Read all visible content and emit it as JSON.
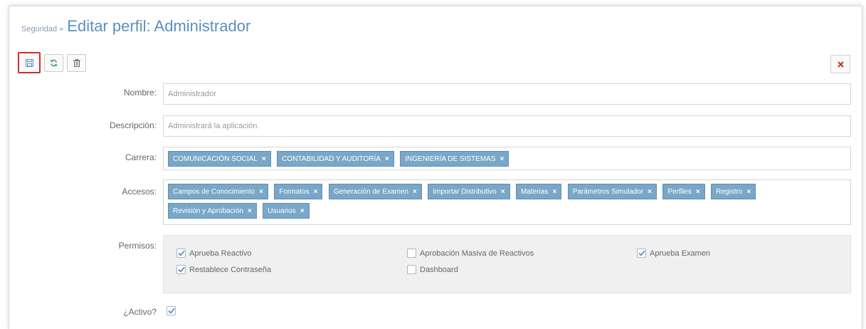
{
  "breadcrumb": {
    "parent": "Seguridad",
    "separator": "»",
    "title": "Editar perfil: Administrador"
  },
  "toolbar": {
    "save_icon": "floppy-disk-icon",
    "refresh_icon": "refresh-icon",
    "delete_icon": "trash-icon",
    "close_icon": "close-icon"
  },
  "form": {
    "nombre_label": "Nombre:",
    "nombre_value": "Administrador",
    "descripcion_label": "Descripción:",
    "descripcion_value": "Administrará la aplicación.",
    "carrera_label": "Carrera:",
    "carreras": [
      "COMUNICACIÓN SOCIAL",
      "CONTABILIDAD Y AUDITORÍA",
      "INGENIERÍA DE SISTEMAS"
    ],
    "accesos_label": "Accesos:",
    "accesos": [
      "Campos de Conocimiento",
      "Formatos",
      "Generación de Examen",
      "Importar Distributivo",
      "Materias",
      "Parámetros Simulador",
      "Perfiles",
      "Registro",
      "Revisión y Aprobación",
      "Usuarios"
    ],
    "permisos_label": "Permisos:",
    "permisos": [
      {
        "label": "Aprueba Reactivo",
        "checked": true
      },
      {
        "label": "Aprobación Masiva de Reactivos",
        "checked": false
      },
      {
        "label": "Aprueba Examen",
        "checked": true
      },
      {
        "label": "Restablece Contraseña",
        "checked": true
      },
      {
        "label": "Dashboard",
        "checked": false
      }
    ],
    "activo_label": "¿Activo?",
    "activo_checked": true
  },
  "colors": {
    "accent": "#5b8fbf",
    "tag": "#7aa7c7",
    "highlight": "#d92b2b",
    "close": "#c0392b"
  }
}
